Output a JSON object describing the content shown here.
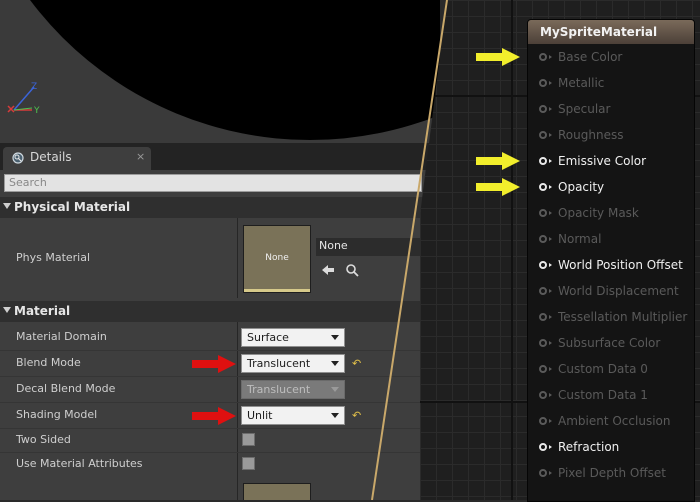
{
  "viewport": {
    "axis_z": "Z",
    "axis_y": "Y"
  },
  "details": {
    "tab_label": "Details",
    "tab_close": "×",
    "search_placeholder": "Search",
    "sections": {
      "physical": "Physical Material",
      "material": "Material"
    },
    "phys_material": {
      "label": "Phys Material",
      "thumb_text": "None",
      "value": "None"
    },
    "rows": {
      "material_domain": {
        "label": "Material Domain",
        "value": "Surface"
      },
      "blend_mode": {
        "label": "Blend Mode",
        "value": "Translucent"
      },
      "decal_blend_mode": {
        "label": "Decal Blend Mode",
        "value": "Translucent"
      },
      "shading_model": {
        "label": "Shading Model",
        "value": "Unlit"
      },
      "two_sided": {
        "label": "Two Sided"
      },
      "use_material_attributes": {
        "label": "Use Material Attributes"
      }
    },
    "reset_glyph": "↶"
  },
  "node": {
    "title": "MySpriteMaterial",
    "pins": [
      {
        "label": "Base Color",
        "active": false,
        "pointer": true
      },
      {
        "label": "Metallic",
        "active": false,
        "pointer": false
      },
      {
        "label": "Specular",
        "active": false,
        "pointer": false
      },
      {
        "label": "Roughness",
        "active": false,
        "pointer": false
      },
      {
        "label": "Emissive Color",
        "active": true,
        "pointer": true
      },
      {
        "label": "Opacity",
        "active": true,
        "pointer": true
      },
      {
        "label": "Opacity Mask",
        "active": false,
        "pointer": false
      },
      {
        "label": "Normal",
        "active": false,
        "pointer": false
      },
      {
        "label": "World Position Offset",
        "active": true,
        "pointer": false
      },
      {
        "label": "World Displacement",
        "active": false,
        "pointer": false
      },
      {
        "label": "Tessellation Multiplier",
        "active": false,
        "pointer": false
      },
      {
        "label": "Subsurface Color",
        "active": false,
        "pointer": false
      },
      {
        "label": "Custom Data 0",
        "active": false,
        "pointer": false
      },
      {
        "label": "Custom Data 1",
        "active": false,
        "pointer": false
      },
      {
        "label": "Ambient Occlusion",
        "active": false,
        "pointer": false
      },
      {
        "label": "Refraction",
        "active": true,
        "pointer": false
      },
      {
        "label": "Pixel Depth Offset",
        "active": false,
        "pointer": false
      }
    ]
  },
  "colors": {
    "arrow_yellow": "#f2ee2c",
    "arrow_red": "#e01010",
    "axis_z": "#3b64d8",
    "axis_y": "#4fc34f",
    "axis_x": "#d83b3b",
    "thumb": "#7a7258"
  },
  "icons": {
    "tab": "details-magnifier-icon",
    "use_asset": "arrow-left-icon",
    "browse": "magnifier-icon",
    "reset": "reset-arrow-icon"
  }
}
